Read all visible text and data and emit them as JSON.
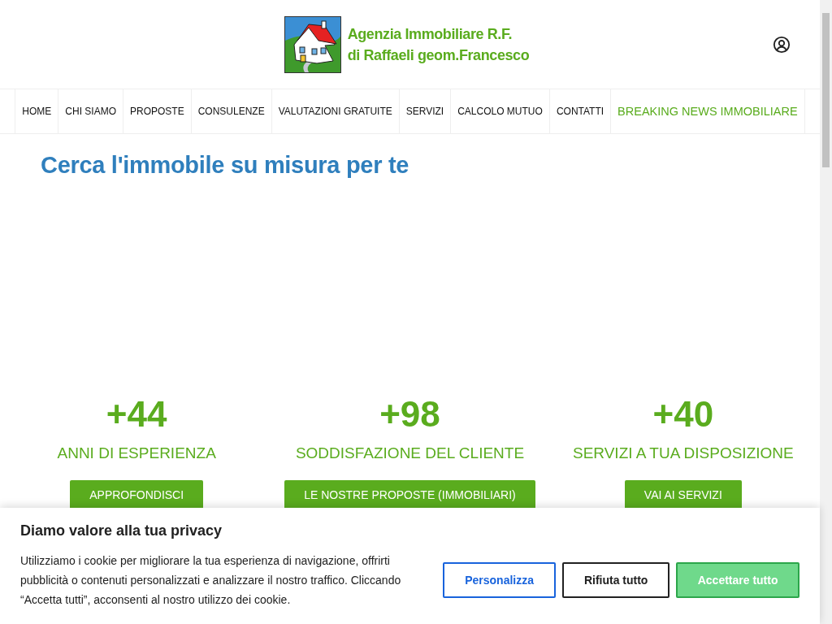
{
  "header": {
    "logo_line_1": "Agenzia Immobiliare R.F.",
    "logo_line_2": "di Raffaeli geom.Francesco"
  },
  "nav": [
    {
      "label": "HOME",
      "kind": "plain"
    },
    {
      "label": "CHI SIAMO",
      "kind": "plain"
    },
    {
      "label": "PROPOSTE",
      "kind": "plain"
    },
    {
      "label": "CONSULENZE",
      "kind": "plain"
    },
    {
      "label": "VALUTAZIONI GRATUITE",
      "kind": "plain"
    },
    {
      "label": "SERVIZI",
      "kind": "plain"
    },
    {
      "label": "CALCOLO MUTUO",
      "kind": "plain"
    },
    {
      "label": "CONTATTI",
      "kind": "plain"
    },
    {
      "label": "BREAKING NEWS IMMOBILIARE",
      "kind": "highlight"
    }
  ],
  "heading": "Cerca l'immobile su misura per te",
  "stats": [
    {
      "number": "+44",
      "label": "ANNI DI ESPERIENZA",
      "button": "APPROFONDISCI"
    },
    {
      "number": "+98",
      "label": "SODDISFAZIONE DEL CLIENTE",
      "button": "LE NOSTRE PROPOSTE (IMMOBILIARI)"
    },
    {
      "number": "+40",
      "label": "SERVIZI A TUA DISPOSIZIONE",
      "button": "VAI AI SERVIZI"
    }
  ],
  "cookie_banner": {
    "title": "Diamo valore alla tua privacy",
    "text": "Utilizziamo i cookie per migliorare la tua esperienza di navigazione, offrirti pubblicità o contenuti personalizzati e analizzare il nostro traffico. Cliccando “Accetta tutti”, acconsenti al nostro utilizzo dei cookie.",
    "buttons": [
      {
        "label": "Personalizza",
        "kind": "outline"
      },
      {
        "label": "Rifiuta tutto",
        "kind": "dark"
      },
      {
        "label": "Accettare tutto",
        "kind": "primary"
      }
    ]
  }
}
